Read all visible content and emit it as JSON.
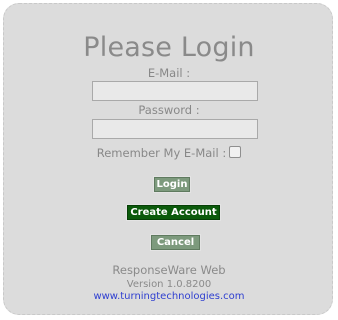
{
  "login": {
    "title": "Please Login",
    "email_label": "E-Mail :",
    "email_value": "",
    "password_label": "Password :",
    "password_value": "",
    "remember_label": "Remember My E-Mail :",
    "remember_checked": false
  },
  "buttons": {
    "login": "Login",
    "create_account": "Create Account",
    "cancel": "Cancel"
  },
  "footer": {
    "app_name": "ResponseWare Web",
    "version": "Version 1.0.8200",
    "link": "www.turningtechnologies.com"
  }
}
